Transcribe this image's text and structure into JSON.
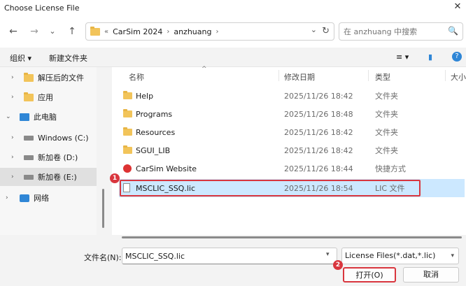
{
  "window": {
    "title": "Choose License File",
    "close_glyph": "✕"
  },
  "nav": {
    "back": "←",
    "forward": "→",
    "recent": "⌄",
    "up": "↑"
  },
  "address": {
    "overflow": "«",
    "crumbs": [
      "CarSim 2024",
      "anzhuang"
    ],
    "sep": "›",
    "dropdown": "⌄",
    "refresh": "↻"
  },
  "search": {
    "placeholder": "在 anzhuang 中搜索",
    "icon": "🔍"
  },
  "toolbar": {
    "organize": "组织 ▾",
    "new_folder": "新建文件夹",
    "view": "≡ ▾",
    "pane": "▮",
    "help": "?"
  },
  "sidebar": {
    "items": [
      {
        "chev": "›",
        "label": "解压后的文件",
        "icon": "folder-icon"
      },
      {
        "chev": "›",
        "label": "应用",
        "icon": "folder-icon"
      },
      {
        "chev": "⌄",
        "label": "此电脑",
        "icon": "computer-icon"
      },
      {
        "chev": "›",
        "label": "Windows (C:)",
        "icon": "drive-icon"
      },
      {
        "chev": "›",
        "label": "新加卷 (D:)",
        "icon": "drive-icon"
      },
      {
        "chev": "›",
        "label": "新加卷 (E:)",
        "icon": "drive-icon"
      },
      {
        "chev": "›",
        "label": "网络",
        "icon": "network-icon"
      }
    ]
  },
  "columns": {
    "name": "名称",
    "modified": "修改日期",
    "type": "类型",
    "size": "大小"
  },
  "files": [
    {
      "name": "Help",
      "modified": "2025/11/26 18:42",
      "type": "文件夹",
      "icon": "folder-icon"
    },
    {
      "name": "Programs",
      "modified": "2025/11/26 18:48",
      "type": "文件夹",
      "icon": "folder-icon"
    },
    {
      "name": "Resources",
      "modified": "2025/11/26 18:42",
      "type": "文件夹",
      "icon": "folder-icon"
    },
    {
      "name": "SGUI_LIB",
      "modified": "2025/11/26 18:42",
      "type": "文件夹",
      "icon": "folder-icon"
    },
    {
      "name": "CarSim Website",
      "modified": "2025/11/26 18:44",
      "type": "快捷方式",
      "icon": "web-shortcut-icon"
    },
    {
      "name": "MSCLIC_SSQ.lic",
      "modified": "2025/11/26 18:54",
      "type": "LIC 文件",
      "icon": "lic-file-icon"
    }
  ],
  "bottom": {
    "filename_label": "文件名(N):",
    "filename_value": "MSCLIC_SSQ.lic",
    "filetype": "License Files(*.dat,*.lic)",
    "open": "打开(O)",
    "cancel": "取消"
  },
  "annotations": {
    "badge1": "1",
    "badge2": "2"
  },
  "colors": {
    "highlight": "#d9363e",
    "selection": "#cce8ff",
    "folder": "#f2c45a"
  }
}
